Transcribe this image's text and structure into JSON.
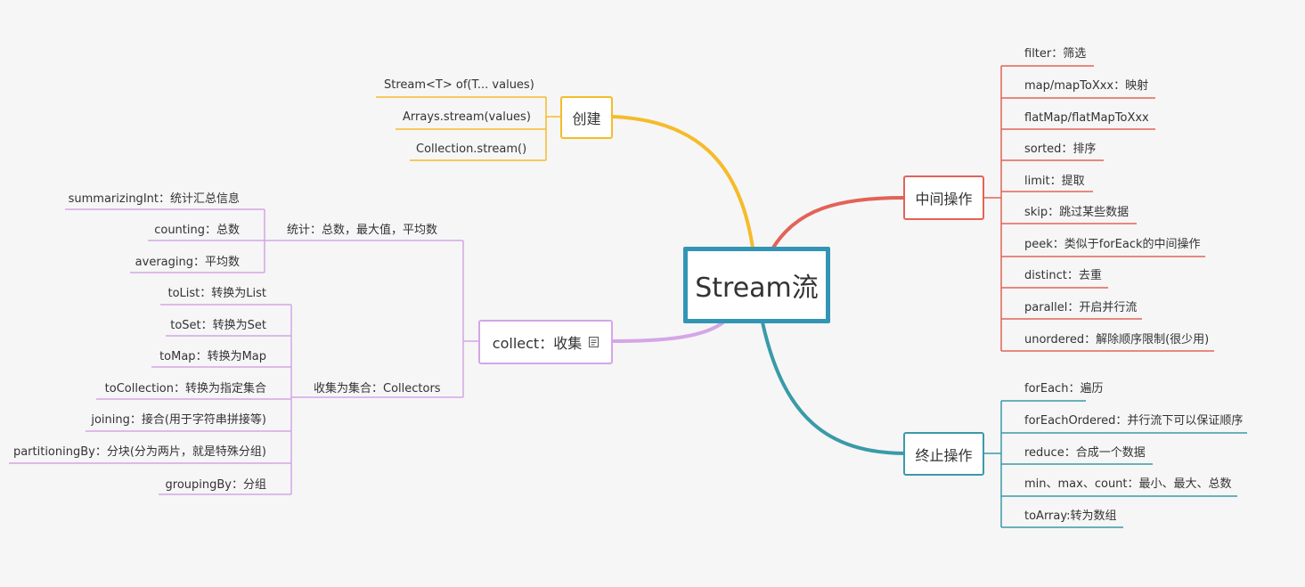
{
  "central": "Stream流",
  "branches": {
    "create": {
      "label": "创建",
      "color": "#f5bb2a",
      "items": [
        "Stream<T> of(T... values)",
        "Arrays.stream(values)",
        "Collection.stream()"
      ]
    },
    "intermediate": {
      "label": "中间操作",
      "color": "#e26356",
      "items": [
        "filter：筛选",
        "map/mapToXxx：映射",
        "flatMap/flatMapToXxx",
        "sorted：排序",
        "limit：提取",
        "skip：跳过某些数据",
        "peek：类似于forEack的中间操作",
        "distinct：去重",
        "parallel：开启并行流",
        "unordered：解除顺序限制(很少用)"
      ]
    },
    "terminal": {
      "label": "终止操作",
      "color": "#3a9aa8",
      "items": [
        "forEach：遍历",
        "forEachOrdered：并行流下可以保证顺序",
        "reduce：合成一个数据",
        "min、max、count：最小、最大、总数",
        "toArray:转为数组"
      ]
    },
    "collect": {
      "label": "collect：收集",
      "icon": "note-icon",
      "color": "#d4a6e6",
      "stats": {
        "label": "统计：总数，最大值，平均数",
        "items": [
          "summarizingInt：统计汇总信息",
          "counting：总数",
          "averaging：平均数"
        ]
      },
      "collectors": {
        "label": "收集为集合：Collectors",
        "items": [
          "toList：转换为List",
          "toSet：转换为Set",
          "toMap：转换为Map",
          "toCollection：转换为指定集合",
          "joining：接合(用于字符串拼接等)",
          "partitioningBy：分块(分为两片，就是特殊分组)",
          "groupingBy：分组"
        ]
      }
    }
  }
}
